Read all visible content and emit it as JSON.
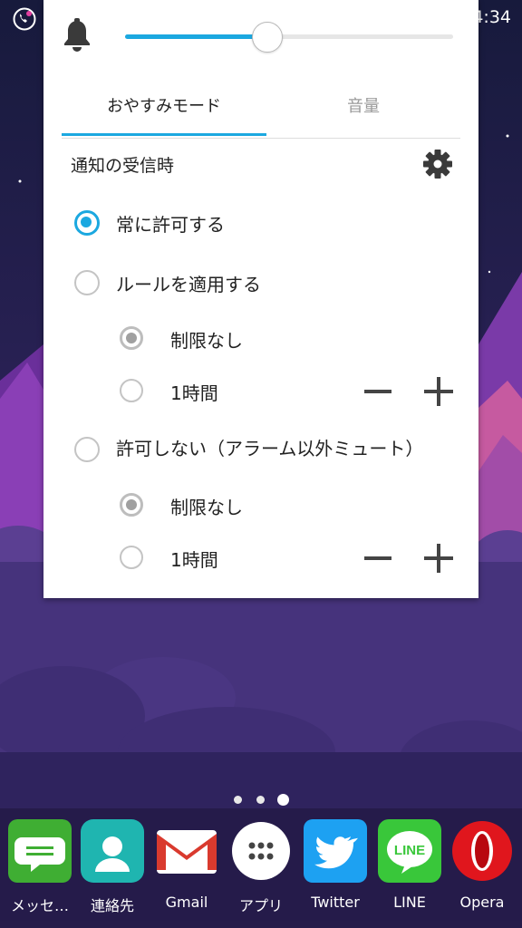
{
  "status_bar": {
    "time": "4:34",
    "call_icon": "phone-call-icon"
  },
  "notification_panel": {
    "volume_slider": {
      "level": 0.43,
      "icon": "bell-icon"
    },
    "tabs": [
      {
        "label": "おやすみモード",
        "active": true
      },
      {
        "label": "音量",
        "active": false
      }
    ],
    "section_title": "通知の受信時",
    "settings_icon": "gear-icon",
    "options": {
      "always_allow": {
        "label": "常に許可する",
        "selected": true
      },
      "apply_rules": {
        "label": "ルールを適用する",
        "sub_unlimited": "制限なし",
        "sub_one_hour": "1時間"
      },
      "dont_allow": {
        "label": "許可しない（アラーム以外ミュート）",
        "sub_unlimited": "制限なし",
        "sub_one_hour": "1時間"
      }
    }
  },
  "page_indicator": {
    "count": 3,
    "active": 3
  },
  "dock": {
    "apps": [
      {
        "label": "メッセ…",
        "icon": "messages-icon"
      },
      {
        "label": "連絡先",
        "icon": "contacts-icon"
      },
      {
        "label": "Gmail",
        "icon": "gmail-icon"
      },
      {
        "label": "アプリ",
        "icon": "app-drawer-icon"
      },
      {
        "label": "Twitter",
        "icon": "twitter-icon"
      },
      {
        "label": "LINE",
        "icon": "line-icon"
      },
      {
        "label": "Opera",
        "icon": "opera-icon"
      }
    ]
  },
  "colors": {
    "accent": "#1ba8e0",
    "panel_bg": "#ffffff"
  }
}
